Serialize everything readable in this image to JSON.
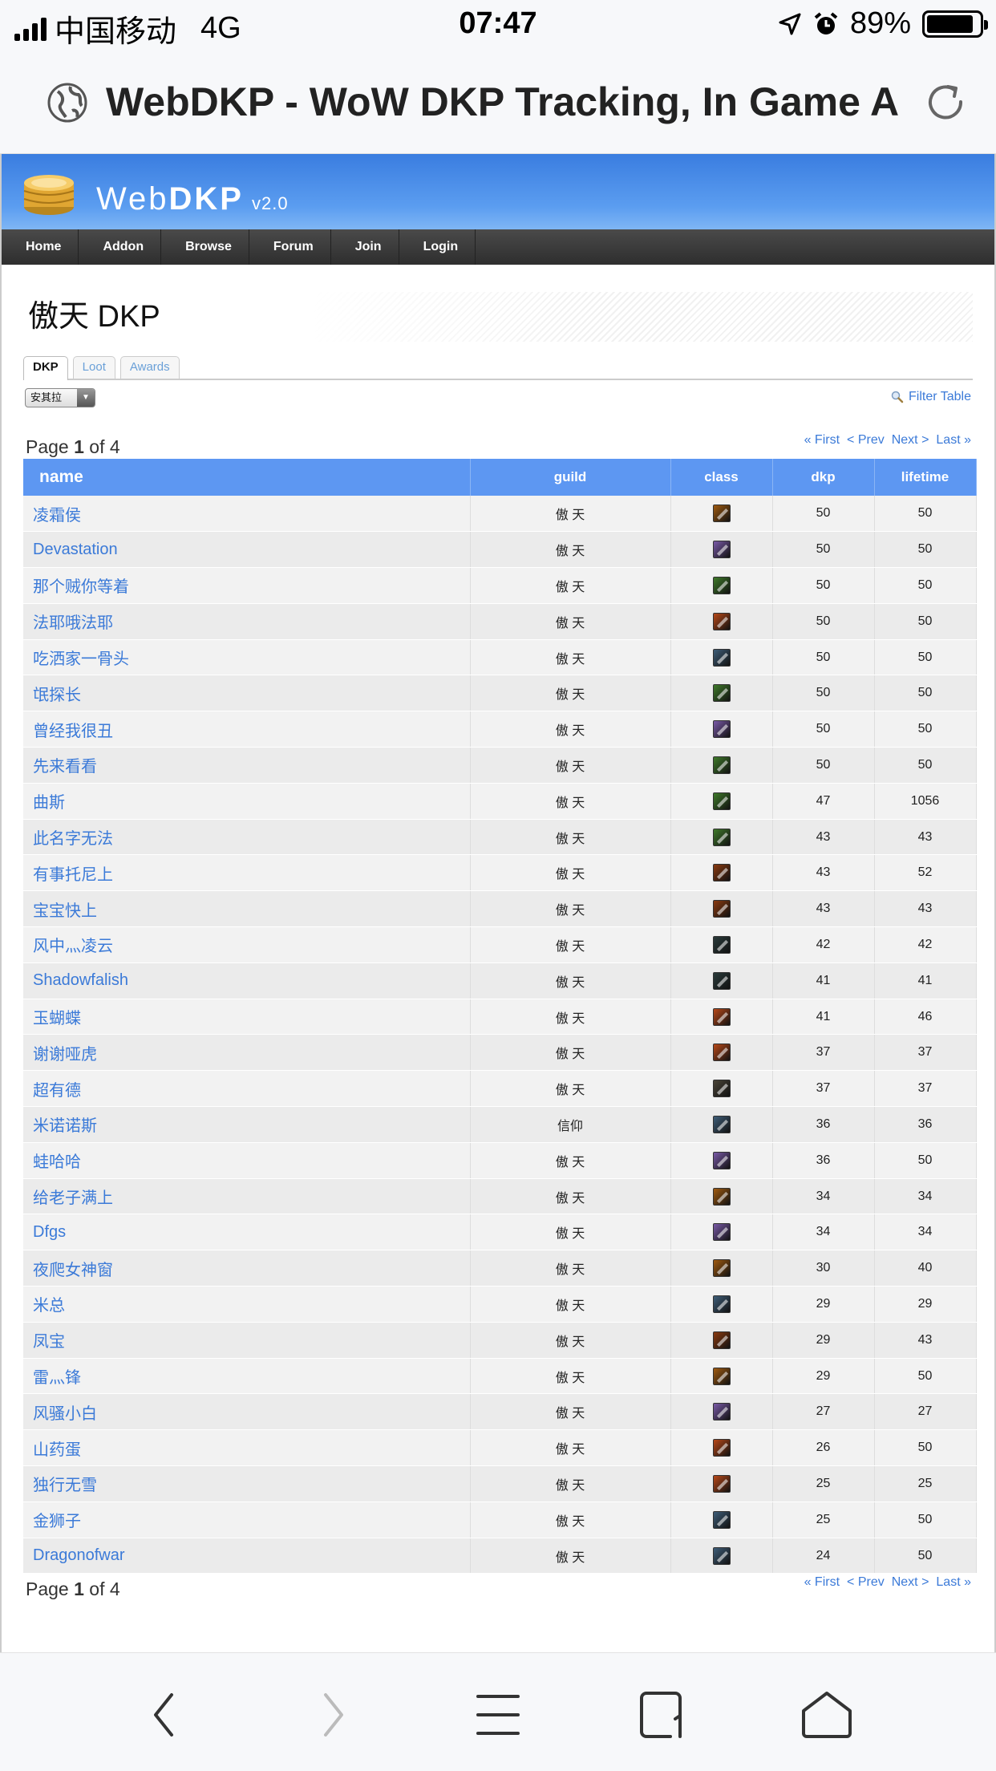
{
  "status_bar": {
    "carrier": "中国移动",
    "network": "4G",
    "time": "07:47",
    "battery": "89%",
    "battery_level": 0.89
  },
  "browser": {
    "page_title": "WebDKP - WoW DKP Tracking, In Game A..."
  },
  "site": {
    "logo": {
      "web": "Web",
      "dkp": "DKP",
      "version": "v2.0"
    },
    "nav": [
      "Home",
      "Addon",
      "Browse",
      "Forum",
      "Join",
      "Login"
    ],
    "page_heading": "傲天 DKP",
    "tabs": [
      {
        "label": "DKP",
        "active": true
      },
      {
        "label": "Loot",
        "active": false
      },
      {
        "label": "Awards",
        "active": false
      }
    ],
    "table_select": "安其拉",
    "filter_label": "Filter Table",
    "pagination": {
      "prefix": "Page",
      "current": "1",
      "of": "of",
      "total": "4",
      "first": "« First",
      "prev": "< Prev",
      "next": "Next >",
      "last": "Last »"
    },
    "columns": [
      "name",
      "guild",
      "class",
      "dkp",
      "lifetime"
    ],
    "rows": [
      {
        "name": "凌霜侯",
        "guild": "傲 天",
        "class_icon": "#a05a10",
        "dkp": "50",
        "lifetime": "50"
      },
      {
        "name": "Devastation",
        "guild": "傲 天",
        "class_icon": "#7a5aa8",
        "dkp": "50",
        "lifetime": "50"
      },
      {
        "name": "那个贼你等着",
        "guild": "傲 天",
        "class_icon": "#3f7a2a",
        "dkp": "50",
        "lifetime": "50"
      },
      {
        "name": "法耶哦法耶",
        "guild": "傲 天",
        "class_icon": "#b84818",
        "dkp": "50",
        "lifetime": "50"
      },
      {
        "name": "吃洒家一骨头",
        "guild": "傲 天",
        "class_icon": "#3e5d78",
        "dkp": "50",
        "lifetime": "50"
      },
      {
        "name": "氓探长",
        "guild": "傲 天",
        "class_icon": "#3f7a2a",
        "dkp": "50",
        "lifetime": "50"
      },
      {
        "name": "曾经我很丑",
        "guild": "傲 天",
        "class_icon": "#7a5aa8",
        "dkp": "50",
        "lifetime": "50"
      },
      {
        "name": "先来看看",
        "guild": "傲 天",
        "class_icon": "#3f7a2a",
        "dkp": "50",
        "lifetime": "50"
      },
      {
        "name": "曲斯",
        "guild": "傲 天",
        "class_icon": "#3f7a2a",
        "dkp": "47",
        "lifetime": "1056"
      },
      {
        "name": "此名字无法",
        "guild": "傲 天",
        "class_icon": "#3f7a2a",
        "dkp": "43",
        "lifetime": "43"
      },
      {
        "name": "有事托尼上",
        "guild": "傲 天",
        "class_icon": "#8a3a10",
        "dkp": "43",
        "lifetime": "52"
      },
      {
        "name": "宝宝快上",
        "guild": "傲 天",
        "class_icon": "#8a3a10",
        "dkp": "43",
        "lifetime": "43"
      },
      {
        "name": "风中灬凌云",
        "guild": "傲 天",
        "class_icon": "#2a3a3a",
        "dkp": "42",
        "lifetime": "42"
      },
      {
        "name": "Shadowfalish",
        "guild": "傲 天",
        "class_icon": "#2a3a3a",
        "dkp": "41",
        "lifetime": "41"
      },
      {
        "name": "玉蝴蝶",
        "guild": "傲 天",
        "class_icon": "#b84818",
        "dkp": "41",
        "lifetime": "46"
      },
      {
        "name": "谢谢哑虎",
        "guild": "傲 天",
        "class_icon": "#b84818",
        "dkp": "37",
        "lifetime": "37"
      },
      {
        "name": "超有德",
        "guild": "傲 天",
        "class_icon": "#4a4438",
        "dkp": "37",
        "lifetime": "37"
      },
      {
        "name": "米诺诺斯",
        "guild": "信仰",
        "class_icon": "#3e5d78",
        "dkp": "36",
        "lifetime": "36"
      },
      {
        "name": "蛙哈哈",
        "guild": "傲 天",
        "class_icon": "#7a5aa8",
        "dkp": "36",
        "lifetime": "50"
      },
      {
        "name": "给老子满上",
        "guild": "傲 天",
        "class_icon": "#a05a10",
        "dkp": "34",
        "lifetime": "34"
      },
      {
        "name": "Dfgs",
        "guild": "傲 天",
        "class_icon": "#7a5aa8",
        "dkp": "34",
        "lifetime": "34"
      },
      {
        "name": "夜爬女神窗",
        "guild": "傲 天",
        "class_icon": "#a05a10",
        "dkp": "30",
        "lifetime": "40"
      },
      {
        "name": "米总",
        "guild": "傲 天",
        "class_icon": "#3e5d78",
        "dkp": "29",
        "lifetime": "29"
      },
      {
        "name": "凤宝",
        "guild": "傲 天",
        "class_icon": "#8a3a10",
        "dkp": "29",
        "lifetime": "43"
      },
      {
        "name": "雷灬锋",
        "guild": "傲 天",
        "class_icon": "#a05a10",
        "dkp": "29",
        "lifetime": "50"
      },
      {
        "name": "风骚小白",
        "guild": "傲 天",
        "class_icon": "#7a5aa8",
        "dkp": "27",
        "lifetime": "27"
      },
      {
        "name": "山药蛋",
        "guild": "傲 天",
        "class_icon": "#b84818",
        "dkp": "26",
        "lifetime": "50"
      },
      {
        "name": "独行无雪",
        "guild": "傲 天",
        "class_icon": "#b84818",
        "dkp": "25",
        "lifetime": "25"
      },
      {
        "name": "金狮子",
        "guild": "傲 天",
        "class_icon": "#3e5d78",
        "dkp": "25",
        "lifetime": "50"
      },
      {
        "name": "Dragonofwar",
        "guild": "傲 天",
        "class_icon": "#3e5d78",
        "dkp": "24",
        "lifetime": "50"
      }
    ]
  },
  "toolbar_icons": [
    "back-icon",
    "forward-icon",
    "menu-icon",
    "tabs-icon",
    "home-icon"
  ]
}
